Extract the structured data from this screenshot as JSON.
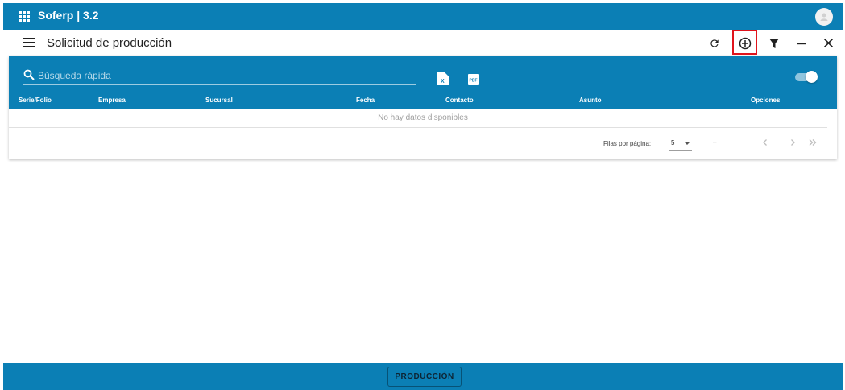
{
  "app": {
    "title": "Soferp | 3.2"
  },
  "header": {
    "title": "Solicitud de producción"
  },
  "toolbar": {
    "icons": [
      "refresh-icon",
      "add-circle-icon",
      "filter-icon",
      "minimize-icon",
      "close-icon"
    ]
  },
  "search": {
    "placeholder": "Búsqueda rápida"
  },
  "table": {
    "columns": [
      "Serie/Folio",
      "Empresa",
      "Sucursal",
      "Fecha",
      "Contacto",
      "Asunto",
      "Opciones"
    ],
    "empty_text": "No hay datos disponibles"
  },
  "pagination": {
    "rows_label": "Filas por página:",
    "rows_value": "5",
    "range": "–"
  },
  "footer": {
    "button_label": "PRODUCCIÓN"
  },
  "colors": {
    "primary": "#0b7fb5",
    "highlight": "#e0141c"
  }
}
